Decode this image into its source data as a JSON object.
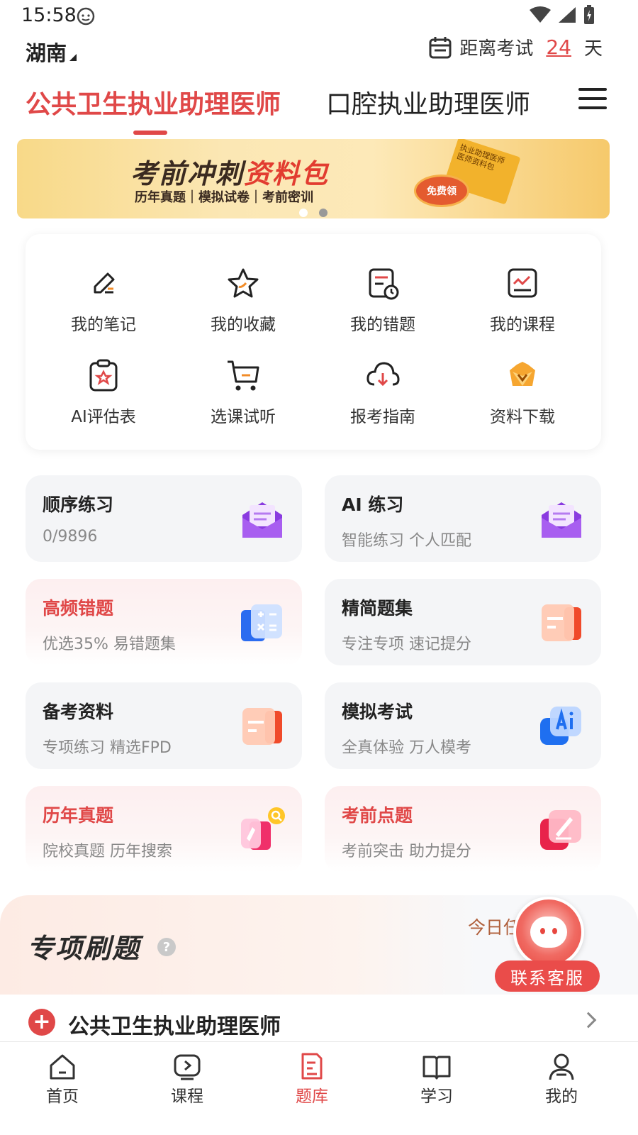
{
  "status_bar": {
    "time": "15:58"
  },
  "header": {
    "province": "湖南",
    "countdown": {
      "prefix": "距离考试",
      "days": "24",
      "suffix": "天"
    }
  },
  "tabs": [
    {
      "label": "公共卫生执业助理医师",
      "active": true
    },
    {
      "label": "口腔执业助理医师",
      "active": false
    }
  ],
  "banner": {
    "title_part1": "考前冲刺",
    "title_part2": "资料包",
    "subtitle": "历年真题｜模拟试卷｜考前密训",
    "seal": "免费领",
    "book": "执业助理医师 医师资料包"
  },
  "quick_items": [
    {
      "label": "我的笔记",
      "icon": "pencil-note-icon"
    },
    {
      "label": "我的收藏",
      "icon": "star-icon"
    },
    {
      "label": "我的错题",
      "icon": "wrong-questions-icon"
    },
    {
      "label": "我的课程",
      "icon": "course-chart-icon"
    },
    {
      "label": "AI评估表",
      "icon": "clipboard-star-icon"
    },
    {
      "label": "选课试听",
      "icon": "cart-icon"
    },
    {
      "label": "报考指南",
      "icon": "cloud-download-icon"
    },
    {
      "label": "资料下载",
      "icon": "crown-icon"
    }
  ],
  "practice_cards": [
    {
      "title": "顺序练习",
      "subtitle": "0/9896",
      "icon": "purple-envelope-icon"
    },
    {
      "title": "AI 练习",
      "subtitle": "智能练习 个人匹配",
      "icon": "purple-envelope-icon"
    },
    {
      "title": "高频错题",
      "subtitle": "优选35% 易错题集",
      "icon": "calculator-icon"
    },
    {
      "title": "精简题集",
      "subtitle": "专注专项 速记提分",
      "icon": "orange-folder-icon"
    },
    {
      "title": "备考资料",
      "subtitle": "专项练习 精选FPD",
      "icon": "orange-folder-icon"
    },
    {
      "title": "模拟考试",
      "subtitle": "全真体验 万人模考",
      "icon": "ai-badge-icon"
    },
    {
      "title": "历年真题",
      "subtitle": "院校真题 历年搜索",
      "icon": "search-doc-icon"
    },
    {
      "title": "考前点题",
      "subtitle": "考前突击 助力提分",
      "icon": "pink-pen-icon"
    }
  ],
  "special": {
    "title": "专项刷题",
    "today": "今日任",
    "customer_service": "联系客服"
  },
  "category": {
    "label": "公共卫生执业助理医师"
  },
  "bottom_nav": [
    {
      "label": "首页",
      "icon": "home-icon",
      "active": false
    },
    {
      "label": "课程",
      "icon": "play-course-icon",
      "active": false
    },
    {
      "label": "题库",
      "icon": "question-bank-icon",
      "active": true
    },
    {
      "label": "学习",
      "icon": "book-icon",
      "active": false
    },
    {
      "label": "我的",
      "icon": "user-icon",
      "active": false
    }
  ],
  "colors": {
    "accent": "#e04848",
    "card_bg": "#f4f5f7",
    "pink_card_bg": "#fdeff0"
  }
}
